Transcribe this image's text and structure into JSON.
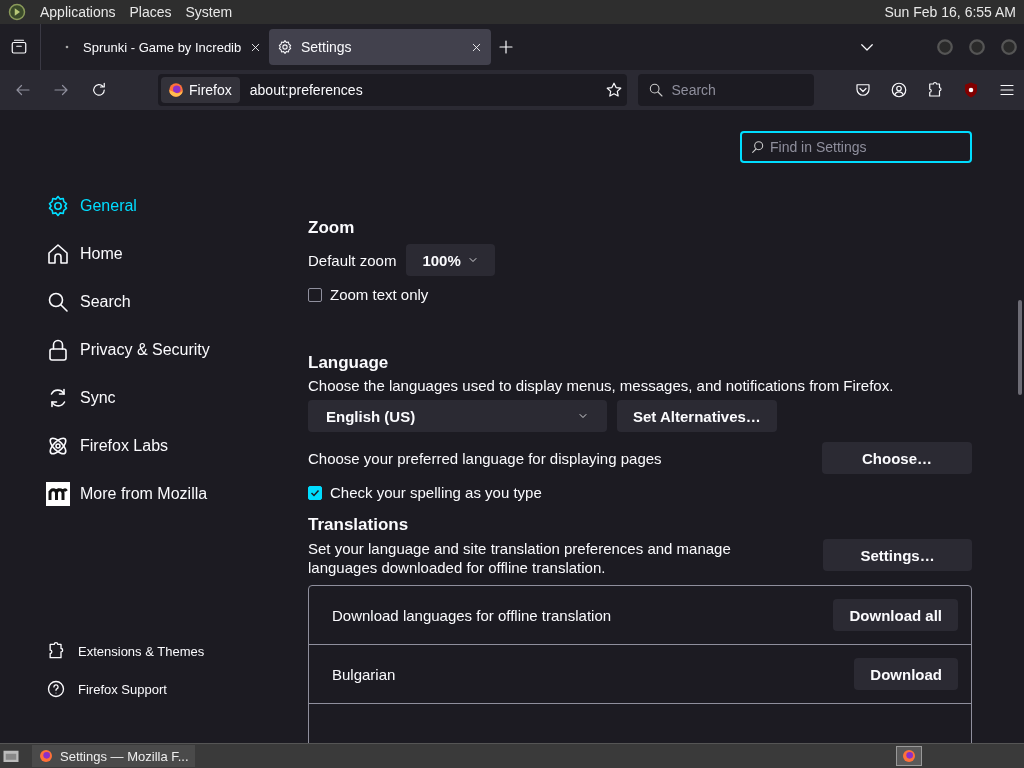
{
  "top_panel": {
    "menus": [
      "Applications",
      "Places",
      "System"
    ],
    "clock": "Sun Feb 16,  6:55 AM"
  },
  "tabs": [
    {
      "title": "Sprunki - Game by Incredib",
      "kind": "dot",
      "selected": false
    },
    {
      "title": "Settings",
      "kind": "gear",
      "selected": true
    }
  ],
  "address_bar": {
    "identity": "Firefox",
    "url": "about:preferences"
  },
  "search": {
    "placeholder": "Search"
  },
  "find": {
    "placeholder": "Find in Settings"
  },
  "sidebar": {
    "items": [
      {
        "label": "General",
        "kind": "gear",
        "selected": true
      },
      {
        "label": "Home",
        "kind": "home",
        "selected": false
      },
      {
        "label": "Search",
        "kind": "search",
        "selected": false
      },
      {
        "label": "Privacy & Security",
        "kind": "lock",
        "selected": false
      },
      {
        "label": "Sync",
        "kind": "sync",
        "selected": false
      },
      {
        "label": "Firefox Labs",
        "kind": "labs",
        "selected": false
      },
      {
        "label": "More from Mozilla",
        "kind": "mozilla",
        "selected": false
      }
    ],
    "footer": [
      {
        "label": "Extensions & Themes",
        "kind": "puzzle"
      },
      {
        "label": "Firefox Support",
        "kind": "help"
      }
    ]
  },
  "zoom": {
    "heading": "Zoom",
    "default_label": "Default zoom",
    "default_value": "100%",
    "text_only": {
      "label": "Zoom text only",
      "checked": false
    }
  },
  "language": {
    "heading": "Language",
    "description": "Choose the languages used to display menus, messages, and notifications from Firefox.",
    "selected_language": "English (US)",
    "alternatives_button": "Set Alternatives…",
    "pages_label": "Choose your preferred language for displaying pages",
    "choose_button": "Choose…",
    "spelling": {
      "label": "Check your spelling as you type",
      "checked": true
    }
  },
  "translations": {
    "heading": "Translations",
    "description": "Set your language and site translation preferences and manage languages downloaded for offline translation.",
    "settings_button": "Settings…",
    "download_rows": [
      {
        "label": "Download languages for offline translation",
        "button": "Download all"
      },
      {
        "label": "Bulgarian",
        "button": "Download"
      }
    ]
  },
  "taskbar": {
    "window": "Settings — Mozilla F..."
  }
}
